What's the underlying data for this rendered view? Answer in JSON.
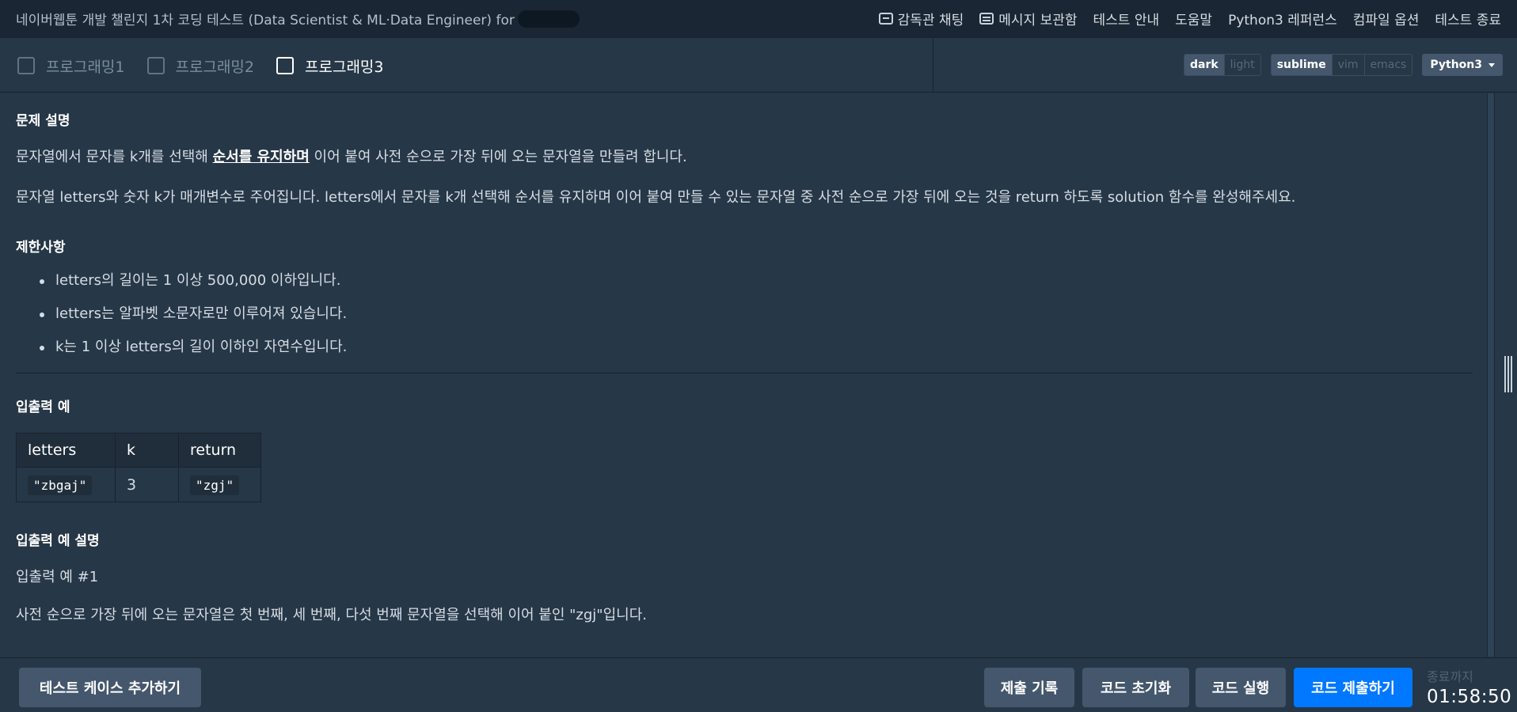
{
  "header": {
    "title": "네이버웹툰 개발 챌린지 1차 코딩 테스트 (Data Scientist & ML·Data Engineer) for",
    "nav": [
      {
        "label": "감독관 채팅",
        "icon": "chat-icon"
      },
      {
        "label": "메시지 보관함",
        "icon": "message-box-icon"
      },
      {
        "label": "테스트 안내"
      },
      {
        "label": "도움말"
      },
      {
        "label": "Python3 레퍼런스"
      },
      {
        "label": "컴파일 옵션"
      },
      {
        "label": "테스트 종료"
      }
    ]
  },
  "tabs": [
    {
      "label": "프로그래밍1",
      "active": false
    },
    {
      "label": "프로그래밍2",
      "active": false
    },
    {
      "label": "프로그래밍3",
      "active": true
    }
  ],
  "editor_options": {
    "theme": [
      "dark",
      "light"
    ],
    "theme_selected": "dark",
    "keymap": [
      "sublime",
      "vim",
      "emacs"
    ],
    "keymap_selected": "sublime",
    "language": "Python3"
  },
  "problem": {
    "desc_heading": "문제 설명",
    "desc_line1_before": "문자열에서 문자를 k개를 선택해 ",
    "desc_line1_emph": "순서를 유지하며",
    "desc_line1_after": " 이어 붙여 사전 순으로 가장 뒤에 오는 문자열을 만들려 합니다.",
    "desc_line2": "문자열 letters와 숫자 k가 매개변수로 주어집니다. letters에서 문자를 k개 선택해 순서를 유지하며 이어 붙여 만들 수 있는 문자열 중 사전 순으로 가장 뒤에 오는 것을 return 하도록 solution 함수를 완성해주세요.",
    "constraints_heading": "제한사항",
    "constraints": [
      "letters의 길이는 1 이상 500,000 이하입니다.",
      "letters는 알파벳 소문자로만 이루어져 있습니다.",
      "k는 1 이상 letters의 길이 이하인 자연수입니다."
    ],
    "io_heading": "입출력 예",
    "io_table": {
      "headers": [
        "letters",
        "k",
        "return"
      ],
      "rows": [
        [
          "\"zbgaj\"",
          "3",
          "\"zgj\""
        ]
      ]
    },
    "io_explain_heading": "입출력 예 설명",
    "io_explain_sub": "입출력 예 #1",
    "io_explain_text": "사전 순으로 가장 뒤에 오는 문자열은 첫 번째, 세 번째, 다섯 번째 문자열을 선택해 이어 붙인 \"zgj\"입니다."
  },
  "footer": {
    "add_testcase": "테스트 케이스 추가하기",
    "submit_history": "제출 기록",
    "reset_code": "코드 초기화",
    "run_code": "코드 실행",
    "submit_code": "코드 제출하기",
    "timer_label": "종료까지",
    "timer_value": "01:58:50"
  },
  "colors": {
    "background": "#263747",
    "topbar": "#1a2633",
    "primary_button": "#0078ff",
    "secondary_button": "#44576c"
  }
}
